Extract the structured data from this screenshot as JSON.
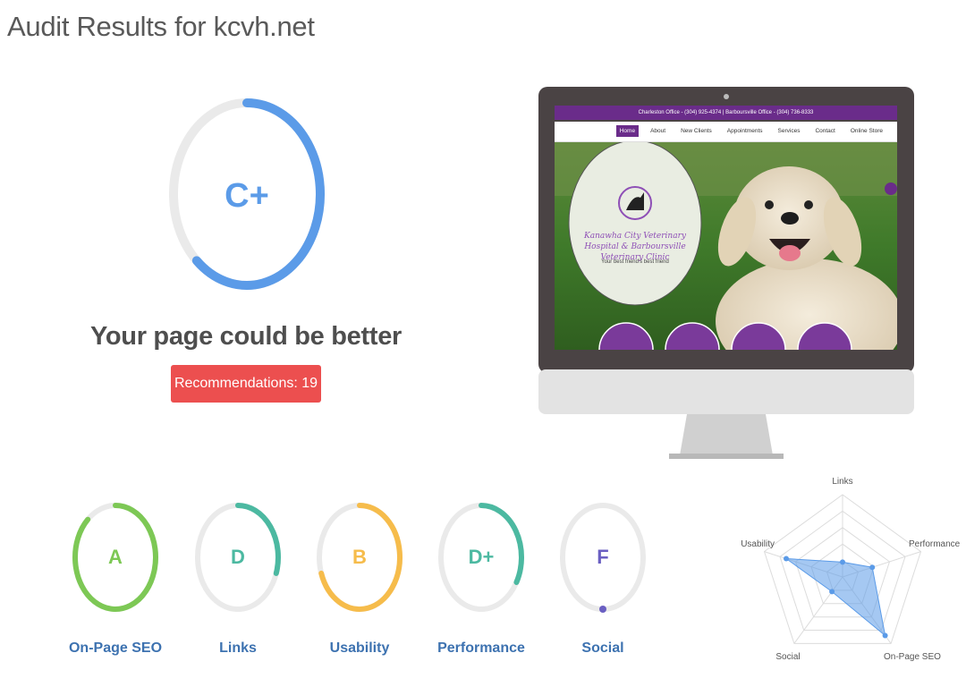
{
  "page_title": "Audit Results for kcvh.net",
  "overall": {
    "grade": "C+",
    "progress": 0.62,
    "color": "#5b9be8"
  },
  "verdict": "Your page could be better",
  "recommendations_label": "Recommendations: 19",
  "preview": {
    "topbar_text": "Charleston Office - (304) 925-4374 | Barboursville Office - (304) 736-8333",
    "nav": [
      "Home",
      "About",
      "New Clients",
      "Appointments",
      "Services",
      "Contact",
      "Online Store"
    ],
    "logo_text": "Kanawha City Veterinary Hospital & Barboursville Veterinary Clinic",
    "tagline": "Your best friend's best friend"
  },
  "categories": [
    {
      "label": "On-Page SEO",
      "grade": "A",
      "progress": 0.88,
      "color": "#7dc855"
    },
    {
      "label": "Links",
      "grade": "D",
      "progress": 0.3,
      "color": "#4cb9a1"
    },
    {
      "label": "Usability",
      "grade": "B",
      "progress": 0.7,
      "color": "#f6bc4b"
    },
    {
      "label": "Performance",
      "grade": "D+",
      "progress": 0.33,
      "color": "#4cb9a1"
    },
    {
      "label": "Social",
      "grade": "F",
      "progress": 0.0,
      "color": "#6a5fc2"
    }
  ],
  "radar": {
    "axes": [
      "Links",
      "Performance",
      "On-Page SEO",
      "Social",
      "Usability"
    ],
    "values": [
      0.18,
      0.38,
      0.88,
      0.22,
      0.72
    ],
    "color": "#5b9be8"
  }
}
